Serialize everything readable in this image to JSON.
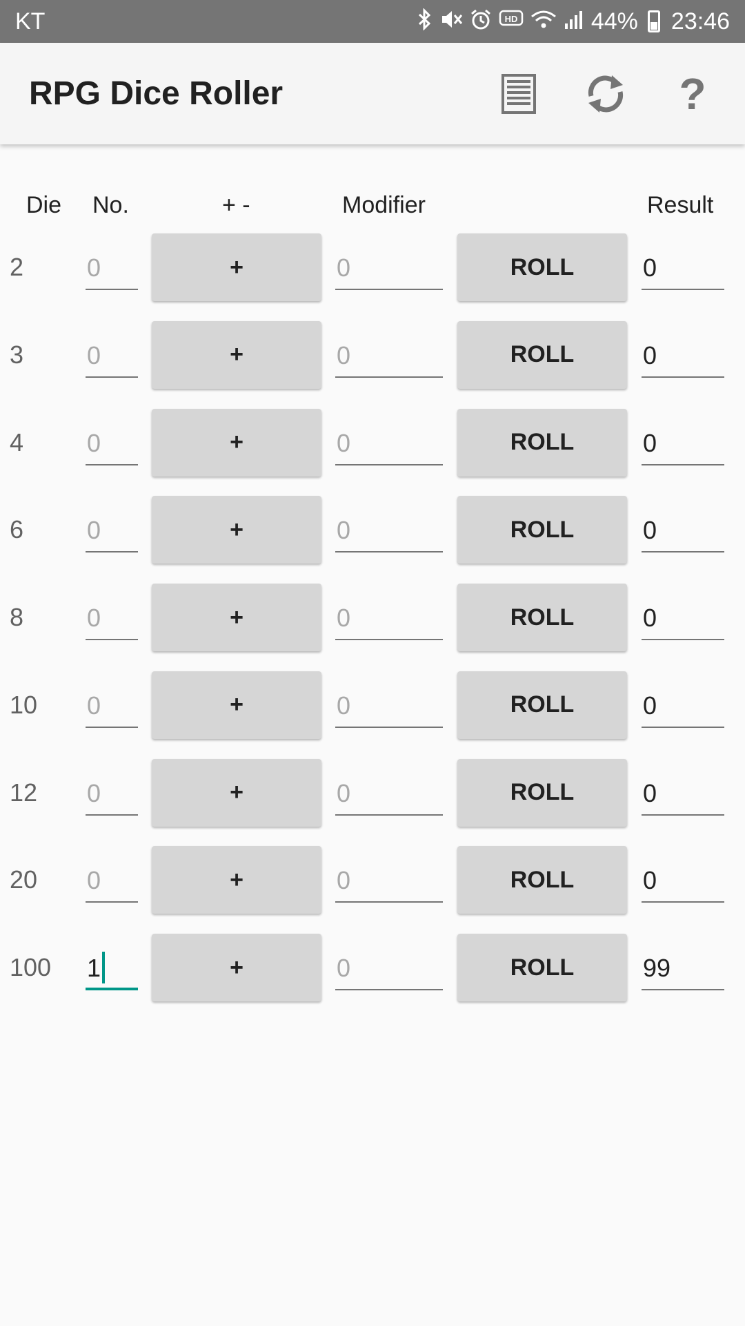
{
  "status_bar": {
    "carrier": "KT",
    "icons": [
      "bluetooth-icon",
      "mute-icon",
      "alarm-icon",
      "hd-voice-icon",
      "wifi-icon",
      "signal-icon"
    ],
    "battery": "44%",
    "time": "23:46"
  },
  "app_bar": {
    "title": "RPG Dice Roller",
    "actions": [
      "history-list-icon",
      "reset-icon",
      "help-icon"
    ],
    "help_glyph": "?"
  },
  "headers": {
    "die": "Die",
    "number": "No.",
    "plus_minus": "+ -",
    "modifier": "Modifier",
    "result": "Result"
  },
  "rows": [
    {
      "die": "2",
      "number_hint": "0",
      "number": "",
      "sign": "+",
      "modifier_hint": "0",
      "roll": "ROLL",
      "result": "0"
    },
    {
      "die": "3",
      "number_hint": "0",
      "number": "",
      "sign": "+",
      "modifier_hint": "0",
      "roll": "ROLL",
      "result": "0"
    },
    {
      "die": "4",
      "number_hint": "0",
      "number": "",
      "sign": "+",
      "modifier_hint": "0",
      "roll": "ROLL",
      "result": "0"
    },
    {
      "die": "6",
      "number_hint": "0",
      "number": "",
      "sign": "+",
      "modifier_hint": "0",
      "roll": "ROLL",
      "result": "0"
    },
    {
      "die": "8",
      "number_hint": "0",
      "number": "",
      "sign": "+",
      "modifier_hint": "0",
      "roll": "ROLL",
      "result": "0"
    },
    {
      "die": "10",
      "number_hint": "0",
      "number": "",
      "sign": "+",
      "modifier_hint": "0",
      "roll": "ROLL",
      "result": "0"
    },
    {
      "die": "12",
      "number_hint": "0",
      "number": "",
      "sign": "+",
      "modifier_hint": "0",
      "roll": "ROLL",
      "result": "0"
    },
    {
      "die": "20",
      "number_hint": "0",
      "number": "",
      "sign": "+",
      "modifier_hint": "0",
      "roll": "ROLL",
      "result": "0"
    },
    {
      "die": "100",
      "number_hint": "0",
      "number": "1",
      "sign": "+",
      "modifier_hint": "0",
      "roll": "ROLL",
      "result": "99"
    }
  ],
  "colors": {
    "accent": "#009688",
    "status_bar": "#757575",
    "app_bar": "#f5f5f5",
    "button": "#d6d6d6"
  }
}
